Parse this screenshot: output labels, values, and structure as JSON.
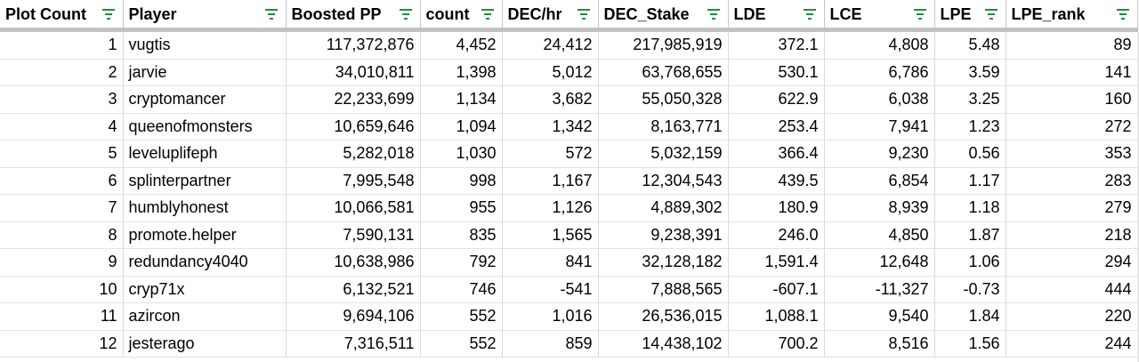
{
  "columns": [
    "Plot Count",
    "Player",
    "Boosted PP",
    "count",
    "DEC/hr",
    "DEC_Stake",
    "LDE",
    "LCE",
    "LPE",
    "LPE_rank"
  ],
  "filter_icon": "filter-icon",
  "accent_color": "#1e8e3e",
  "rows": [
    [
      "1",
      "vugtis",
      "117,372,876",
      "4,452",
      "24,412",
      "217,985,919",
      "372.1",
      "4,808",
      "5.48",
      "89"
    ],
    [
      "2",
      "jarvie",
      "34,010,811",
      "1,398",
      "5,012",
      "63,768,655",
      "530.1",
      "6,786",
      "3.59",
      "141"
    ],
    [
      "3",
      "cryptomancer",
      "22,233,699",
      "1,134",
      "3,682",
      "55,050,328",
      "622.9",
      "6,038",
      "3.25",
      "160"
    ],
    [
      "4",
      "queenofmonsters",
      "10,659,646",
      "1,094",
      "1,342",
      "8,163,771",
      "253.4",
      "7,941",
      "1.23",
      "272"
    ],
    [
      "5",
      "leveluplifeph",
      "5,282,018",
      "1,030",
      "572",
      "5,032,159",
      "366.4",
      "9,230",
      "0.56",
      "353"
    ],
    [
      "6",
      "splinterpartner",
      "7,995,548",
      "998",
      "1,167",
      "12,304,543",
      "439.5",
      "6,854",
      "1.17",
      "283"
    ],
    [
      "7",
      "humblyhonest",
      "10,066,581",
      "955",
      "1,126",
      "4,889,302",
      "180.9",
      "8,939",
      "1.18",
      "279"
    ],
    [
      "8",
      "promote.helper",
      "7,590,131",
      "835",
      "1,565",
      "9,238,391",
      "246.0",
      "4,850",
      "1.87",
      "218"
    ],
    [
      "9",
      "redundancy4040",
      "10,638,986",
      "792",
      "841",
      "32,128,182",
      "1,591.4",
      "12,648",
      "1.06",
      "294"
    ],
    [
      "10",
      "cryp71x",
      "6,132,521",
      "746",
      "-541",
      "7,888,565",
      "-607.1",
      "-11,327",
      "-0.73",
      "444"
    ],
    [
      "11",
      "azircon",
      "9,694,106",
      "552",
      "1,016",
      "26,536,015",
      "1,088.1",
      "9,540",
      "1.84",
      "220"
    ],
    [
      "12",
      "jesterago",
      "7,316,511",
      "552",
      "859",
      "14,438,102",
      "700.2",
      "8,516",
      "1.56",
      "244"
    ]
  ]
}
